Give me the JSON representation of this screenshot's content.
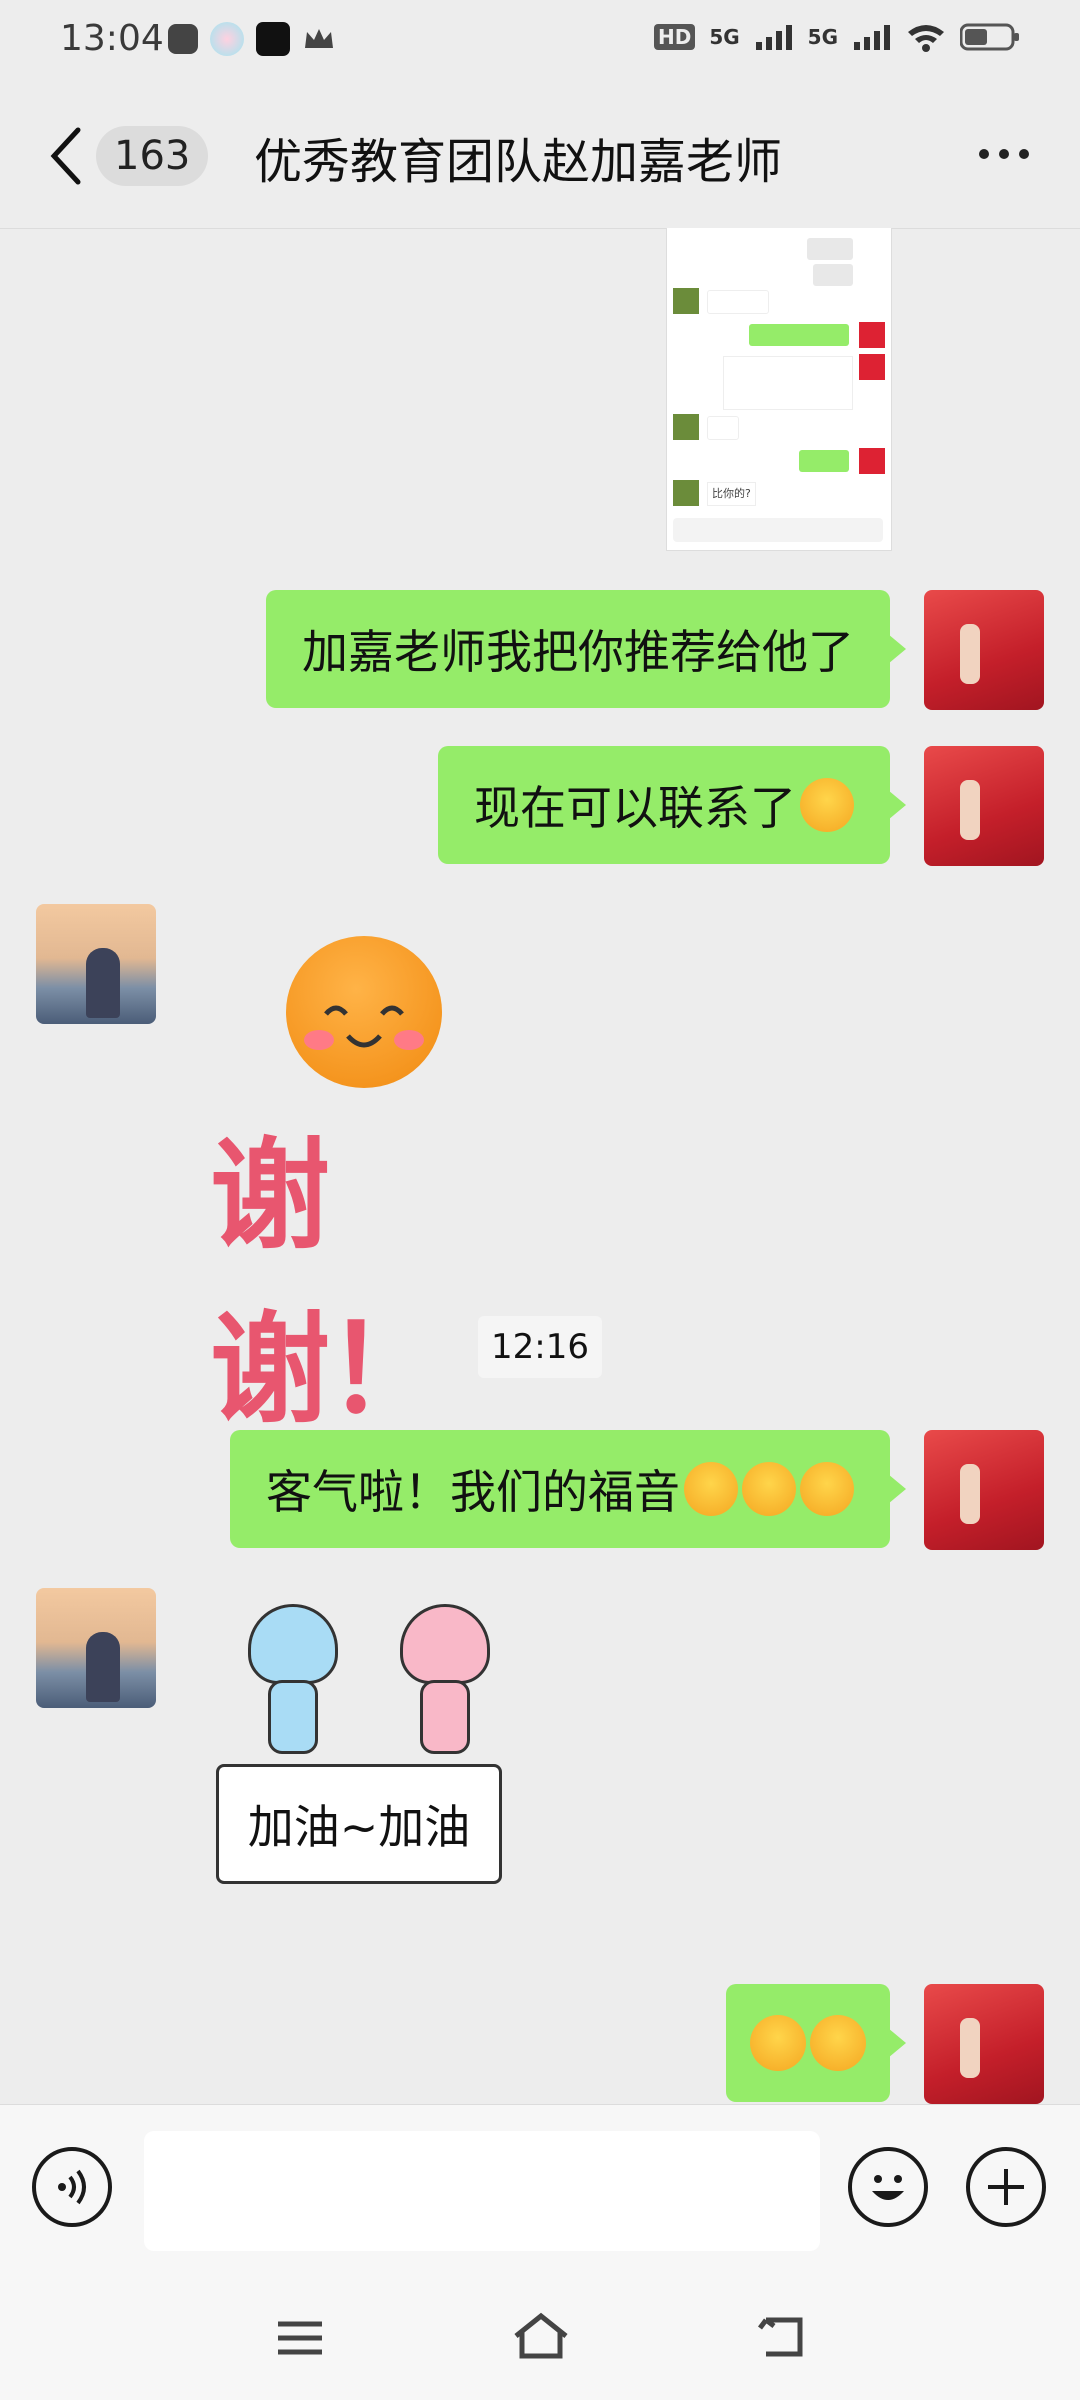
{
  "status_bar": {
    "time": "13:04",
    "network_1": "5G",
    "network_2": "5G",
    "hd_label": "HD"
  },
  "header": {
    "unread_count": "163",
    "title": "优秀教育团队赵加嘉老师"
  },
  "messages": [
    {
      "sender": "me",
      "type": "image",
      "content": "chat screenshot"
    },
    {
      "sender": "me",
      "type": "text",
      "text": "加嘉老师我把你推荐给他了"
    },
    {
      "sender": "me",
      "type": "text",
      "text": "现在可以联系了"
    },
    {
      "sender": "other",
      "type": "sticker",
      "text": "谢谢！"
    },
    {
      "sender": "system",
      "type": "time",
      "text": "12:16"
    },
    {
      "sender": "me",
      "type": "text",
      "text": "客气啦！我们的福音"
    },
    {
      "sender": "other",
      "type": "sticker",
      "text": "加油~加油"
    },
    {
      "sender": "me",
      "type": "emoji",
      "text": ""
    }
  ],
  "mini_screenshot": {
    "caption": "比你的?"
  },
  "colors": {
    "me_bubble": "#95ec69",
    "background": "#ededed",
    "sticker_pink": "#e8566f"
  }
}
